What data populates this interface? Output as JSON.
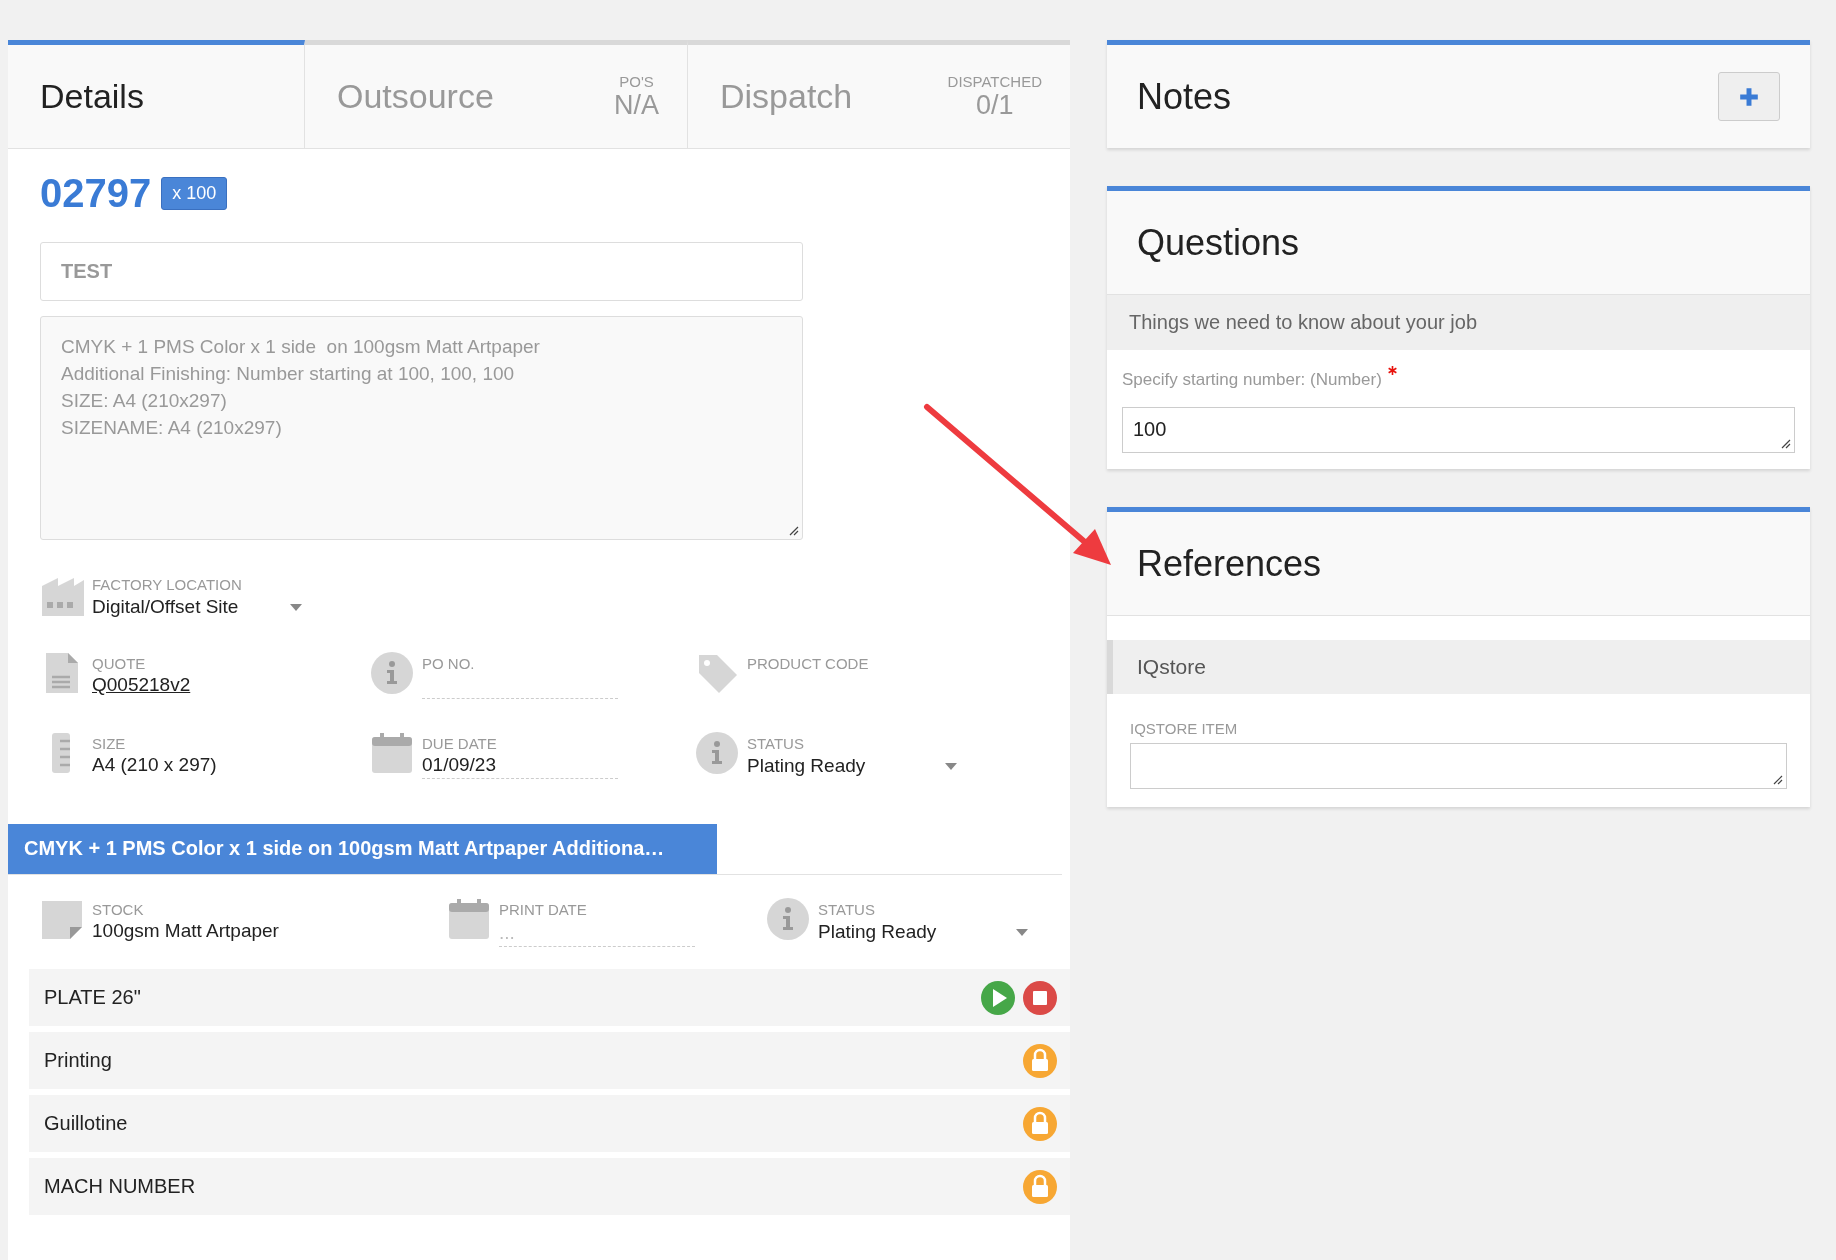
{
  "tabs": [
    {
      "label": "Details",
      "selected": true
    },
    {
      "label": "Outsource",
      "selected": false,
      "caption": "PO'S",
      "value": "N/A"
    },
    {
      "label": "Dispatch",
      "selected": false,
      "caption": "DISPATCHED",
      "value": "0/1"
    }
  ],
  "job": {
    "number": "02797",
    "quantity_badge": "x 100",
    "title": "TEST",
    "description": "CMYK + 1 PMS Color x 1 side  on 100gsm Matt Artpaper\nAdditional Finishing: Number starting at 100, 100, 100\nSIZE: A4 (210x297)\nSIZENAME: A4 (210x297)"
  },
  "detail_rows": [
    [
      {
        "kind": "select",
        "label": "FACTORY LOCATION",
        "value": "Digital/Offset Site"
      }
    ],
    [
      {
        "kind": "link",
        "label": "QUOTE",
        "value": "Q005218v2"
      },
      {
        "kind": "input",
        "label": "PO NO."
      },
      {
        "kind": "text",
        "label": "PRODUCT CODE"
      }
    ],
    [
      {
        "kind": "text",
        "label": "SIZE",
        "value": "A4 (210 x 297)"
      },
      {
        "kind": "input",
        "label": "DUE DATE",
        "value": "01/09/23"
      },
      {
        "kind": "select",
        "label": "STATUS",
        "value": "Plating Ready"
      }
    ]
  ],
  "section_tabs": [
    {
      "label": "CMYK + 1 PMS Color x 1 side on 100gsm Matt Artpaper Additiona…",
      "selected": true
    }
  ],
  "section_fields": [
    {
      "kind": "text",
      "label": "STOCK",
      "value": "100gsm Matt Artpaper"
    },
    {
      "kind": "input",
      "label": "PRINT DATE",
      "placeholder": "..."
    },
    {
      "kind": "select",
      "label": "STATUS",
      "value": "Plating Ready"
    }
  ],
  "tasks": [
    {
      "name": "PLATE 26\"",
      "kind": "startable"
    },
    {
      "name": "Printing",
      "kind": "locked"
    },
    {
      "name": "Guillotine",
      "kind": "locked"
    },
    {
      "name": "MACH NUMBER",
      "kind": "locked"
    }
  ],
  "notes": {
    "title": "Notes"
  },
  "questions": {
    "title": "Questions",
    "subtitle": "Things we need to know about your job",
    "fields": [
      {
        "label": "Specify starting number: (Number)",
        "required": true,
        "value": "100"
      }
    ]
  },
  "references": {
    "title": "References",
    "groups": [
      {
        "name": "IQstore",
        "fields": [
          {
            "label": "IQSTORE ITEM"
          }
        ]
      }
    ]
  }
}
